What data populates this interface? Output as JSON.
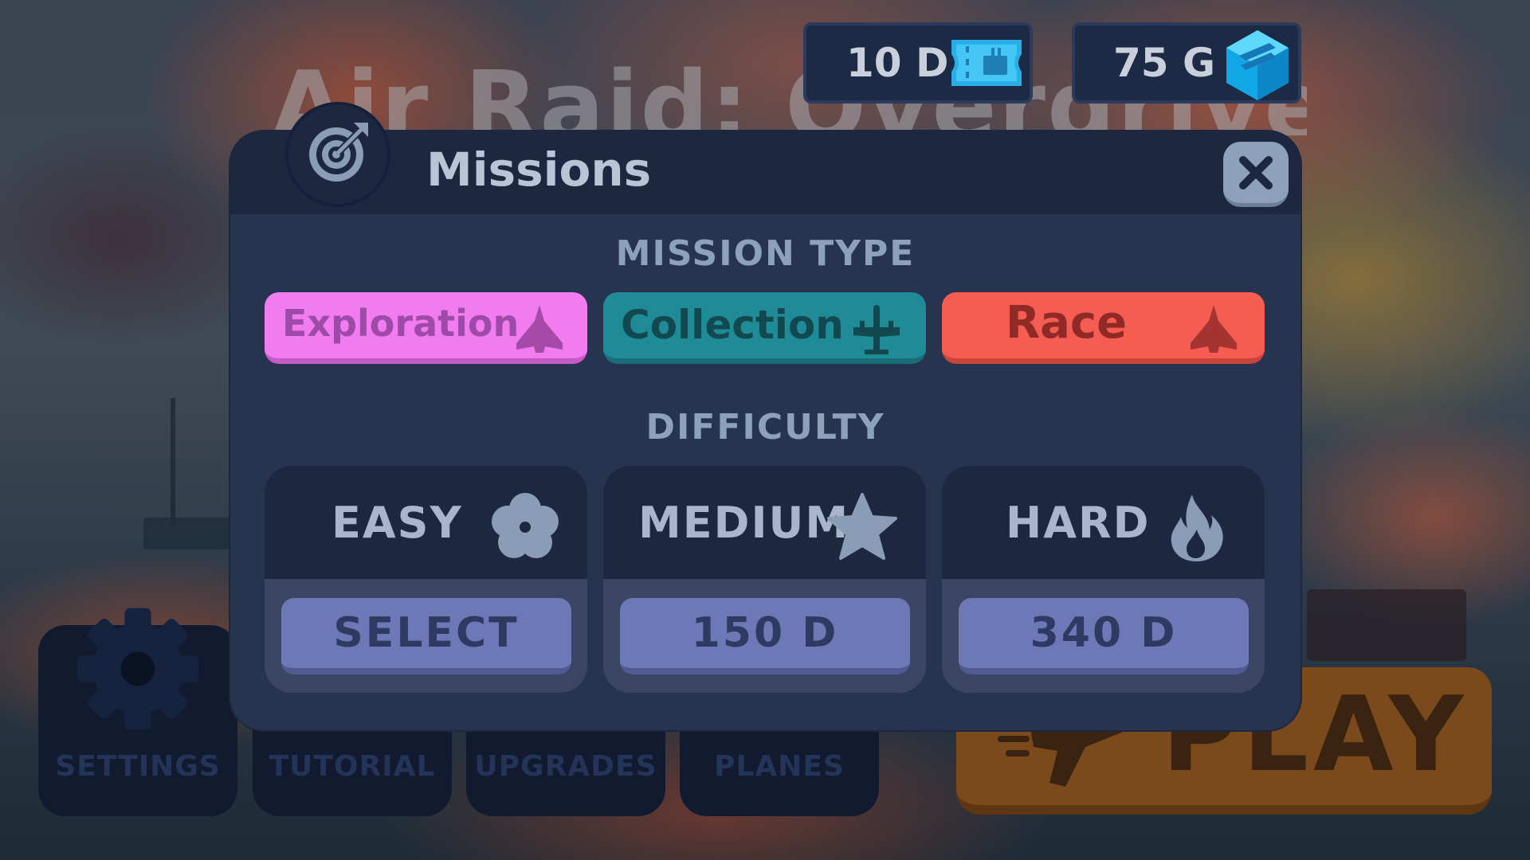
{
  "background": {
    "game_title": "Air Raid: Overdrive"
  },
  "currency": {
    "diamonds": "10 D",
    "diamonds_icon": "ticket-icon",
    "gems": "75 G",
    "gems_icon": "gem-icon"
  },
  "bottom_menu": {
    "settings": "SETTINGS",
    "tutorial": "TUTORIAL",
    "upgrades": "UPGRADES",
    "planes": "PLANES",
    "play": "PLAY"
  },
  "modal": {
    "title": "Missions",
    "icon": "target-icon",
    "close_icon": "close-icon",
    "mission_type_label": "MISSION TYPE",
    "mission_types": [
      {
        "label": "Exploration",
        "icon": "jet-icon",
        "color": "#f17cf0"
      },
      {
        "label": "Collection",
        "icon": "bomber-icon",
        "color": "#1f8b97"
      },
      {
        "label": "Race",
        "icon": "jet-icon",
        "color": "#f55c52"
      }
    ],
    "difficulty_label": "DIFFICULTY",
    "difficulties": [
      {
        "name": "EASY",
        "icon": "flower-icon",
        "action": "SELECT"
      },
      {
        "name": "MEDIUM",
        "icon": "star-icon",
        "action": "150 D"
      },
      {
        "name": "HARD",
        "icon": "flame-icon",
        "action": "340 D"
      }
    ]
  }
}
